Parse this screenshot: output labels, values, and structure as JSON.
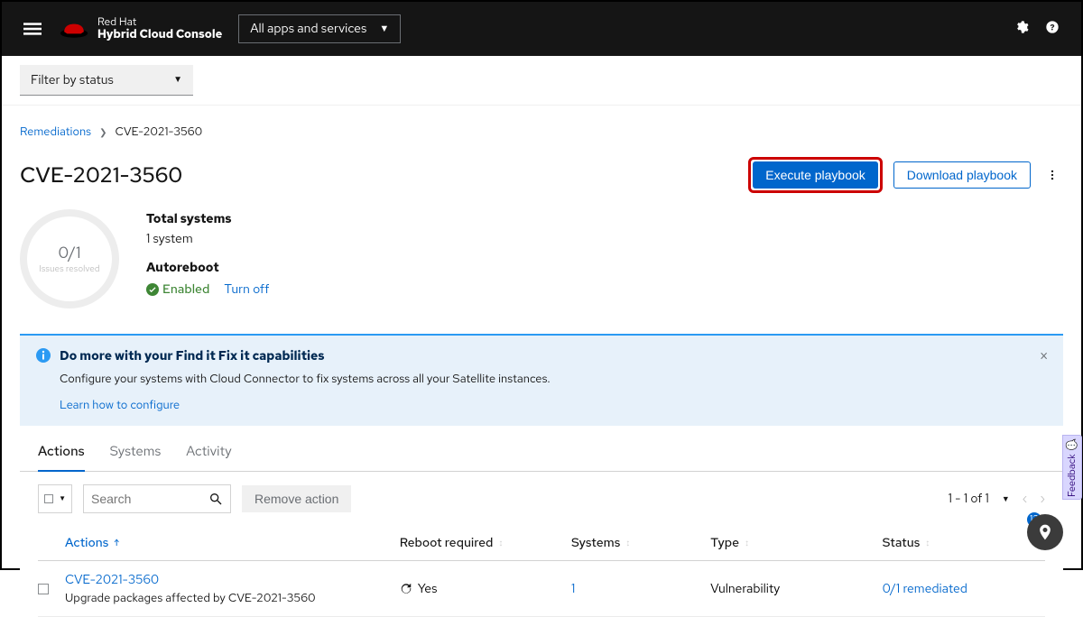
{
  "masthead": {
    "brand_line1": "Red Hat",
    "brand_line2": "Hybrid Cloud Console",
    "apps_label": "All apps and services"
  },
  "subbar": {
    "filter_label": "Filter by status"
  },
  "breadcrumb": {
    "root": "Remediations",
    "current": "CVE-2021-3560"
  },
  "header": {
    "title": "CVE-2021-3560",
    "execute": "Execute playbook",
    "download": "Download playbook"
  },
  "summary": {
    "donut_big": "0/1",
    "donut_small": "Issues resolved",
    "total_systems_label": "Total systems",
    "total_systems_value": "1 system",
    "autoreboot_label": "Autoreboot",
    "enabled": "Enabled",
    "turnoff": "Turn off"
  },
  "alert": {
    "title": "Do more with your Find it Fix it capabilities",
    "desc": "Configure your systems with Cloud Connector to fix systems across all your Satellite instances.",
    "learn": "Learn how to configure"
  },
  "tabs": {
    "actions": "Actions",
    "systems": "Systems",
    "activity": "Activity"
  },
  "toolbar": {
    "search_placeholder": "Search",
    "remove": "Remove action",
    "pagination": "1 - 1 of 1"
  },
  "columns": {
    "actions": "Actions",
    "reboot": "Reboot required",
    "systems": "Systems",
    "type": "Type",
    "status": "Status"
  },
  "row": {
    "title": "CVE-2021-3560",
    "desc": "Upgrade packages affected by CVE-2021-3560",
    "reboot": "Yes",
    "systems": "1",
    "type": "Vulnerability",
    "status": "0/1 remediated"
  },
  "feedback": "Feedback",
  "fab_count": "12"
}
